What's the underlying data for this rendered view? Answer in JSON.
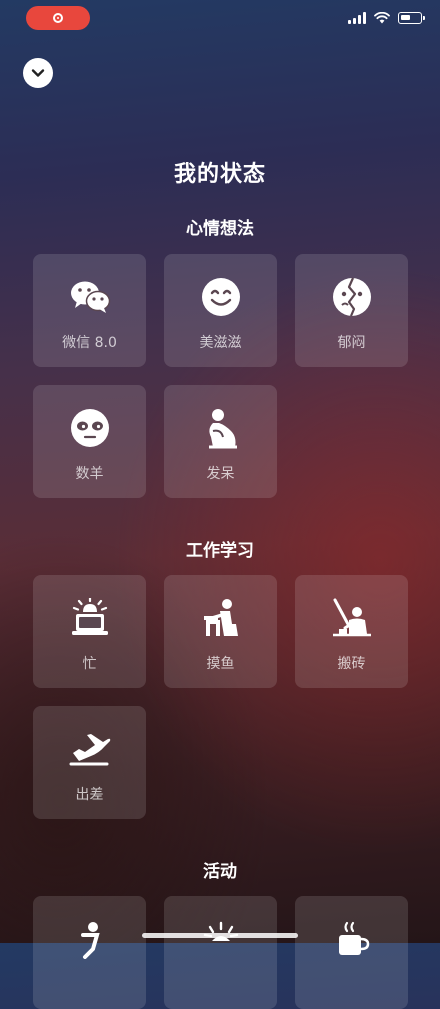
{
  "page": {
    "title": "我的状态"
  },
  "sections": [
    {
      "title": "心情想法",
      "items": [
        {
          "label": "微信 8.0",
          "icon": "wechat-icon"
        },
        {
          "label": "美滋滋",
          "icon": "smile-face-icon"
        },
        {
          "label": "郁闷",
          "icon": "split-face-icon"
        },
        {
          "label": "数羊",
          "icon": "sleepy-face-icon"
        },
        {
          "label": "发呆",
          "icon": "daze-figure-icon"
        }
      ]
    },
    {
      "title": "工作学习",
      "items": [
        {
          "label": "忙",
          "icon": "busy-laptop-icon"
        },
        {
          "label": "摸鱼",
          "icon": "slacking-figure-icon"
        },
        {
          "label": "搬砖",
          "icon": "worker-figure-icon"
        },
        {
          "label": "出差",
          "icon": "airplane-icon"
        }
      ]
    },
    {
      "title": "活动",
      "items": [
        {
          "label": "",
          "icon": "running-figure-icon"
        },
        {
          "label": "",
          "icon": "sun-figure-icon"
        },
        {
          "label": "",
          "icon": "coffee-cup-icon"
        }
      ]
    }
  ],
  "colors": {
    "record_pill": "#e8473d",
    "tile_bg": "rgba(255,255,255,0.13)"
  }
}
